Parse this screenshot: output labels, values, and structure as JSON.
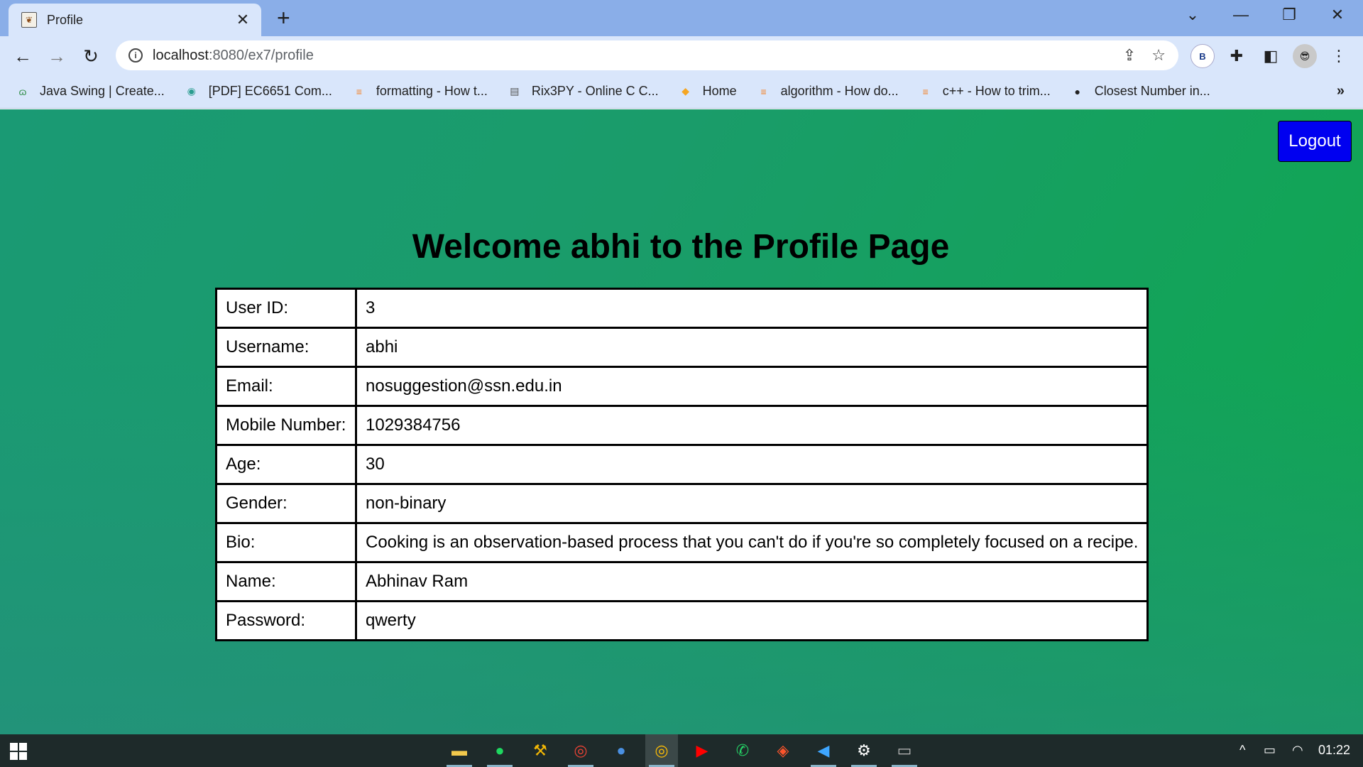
{
  "browser": {
    "tab": {
      "title": "Profile",
      "close": "✕"
    },
    "new_tab": "+",
    "window_controls": {
      "tab_search": "⌄",
      "minimize": "—",
      "restore": "❐",
      "close": "✕"
    },
    "nav": {
      "back": "←",
      "forward": "→",
      "reload": "↻"
    },
    "address": {
      "host": "localhost",
      "path": ":8080/ex7/profile"
    },
    "profile_initial": "B",
    "bookmarks": [
      {
        "label": "Java Swing | Create...",
        "icon": "gfg-icon",
        "glyph": "ɷ",
        "color": "#2f8d46"
      },
      {
        "label": "[PDF] EC6651 Com...",
        "icon": "globe-icon",
        "glyph": "◉",
        "color": "#2a9d8f"
      },
      {
        "label": "formatting - How t...",
        "icon": "stackoverflow-icon",
        "glyph": "≡",
        "color": "#f48024"
      },
      {
        "label": "Rix3PY - Online C C...",
        "icon": "ideone-icon",
        "glyph": "▤",
        "color": "#555555"
      },
      {
        "label": "Home",
        "icon": "box-icon",
        "glyph": "◆",
        "color": "#f5a623"
      },
      {
        "label": "algorithm - How do...",
        "icon": "stackoverflow-icon",
        "glyph": "≡",
        "color": "#f48024"
      },
      {
        "label": "c++ - How to trim...",
        "icon": "stackoverflow-icon",
        "glyph": "≡",
        "color": "#f48024"
      },
      {
        "label": "Closest Number in...",
        "icon": "world-icon",
        "glyph": "●",
        "color": "#222222"
      }
    ],
    "bookmarks_more": "»"
  },
  "page": {
    "logout_label": "Logout",
    "heading": "Welcome abhi to the Profile Page",
    "rows": [
      {
        "label": "User ID:",
        "value": "3"
      },
      {
        "label": "Username:",
        "value": "abhi"
      },
      {
        "label": "Email:",
        "value": "nosuggestion@ssn.edu.in"
      },
      {
        "label": "Mobile Number:",
        "value": "1029384756"
      },
      {
        "label": "Age:",
        "value": "30"
      },
      {
        "label": "Gender:",
        "value": "non-binary"
      },
      {
        "label": "Bio:",
        "value": "Cooking is an observation-based process that you can't do if you're so completely focused on a recipe."
      },
      {
        "label": "Name:",
        "value": "Abhinav Ram"
      },
      {
        "label": "Password:",
        "value": "qwerty"
      }
    ]
  },
  "taskbar": {
    "apps": [
      {
        "name": "file-explorer-icon",
        "glyph": "▬",
        "color": "#f2c94c",
        "running": true
      },
      {
        "name": "spotify-icon",
        "glyph": "●",
        "color": "#1ed760",
        "running": true
      },
      {
        "name": "stackbuilder-icon",
        "glyph": "⚒",
        "color": "#f2b705",
        "running": false
      },
      {
        "name": "chrome-icon",
        "glyph": "◎",
        "color": "#ea4335",
        "running": true
      },
      {
        "name": "spotify-web-icon",
        "glyph": "●",
        "color": "#4a90e2",
        "running": false
      },
      {
        "name": "chrome-active-icon",
        "glyph": "◎",
        "color": "#fbbc05",
        "running": true,
        "active": true
      },
      {
        "name": "youtube-icon",
        "glyph": "▶",
        "color": "#ff0000",
        "running": false
      },
      {
        "name": "whatsapp-icon",
        "glyph": "✆",
        "color": "#25d366",
        "running": false
      },
      {
        "name": "brave-icon",
        "glyph": "◈",
        "color": "#fb542b",
        "running": false
      },
      {
        "name": "vscode-icon",
        "glyph": "◀",
        "color": "#3ea6ff",
        "running": true
      },
      {
        "name": "settings-icon",
        "glyph": "⚙",
        "color": "#ffffff",
        "running": true
      },
      {
        "name": "terminal-icon",
        "glyph": "▭",
        "color": "#bbbbbb",
        "running": true
      }
    ],
    "tray": {
      "chevron": "^",
      "battery": "▭",
      "wifi": "◠"
    },
    "clock": "01:22"
  }
}
